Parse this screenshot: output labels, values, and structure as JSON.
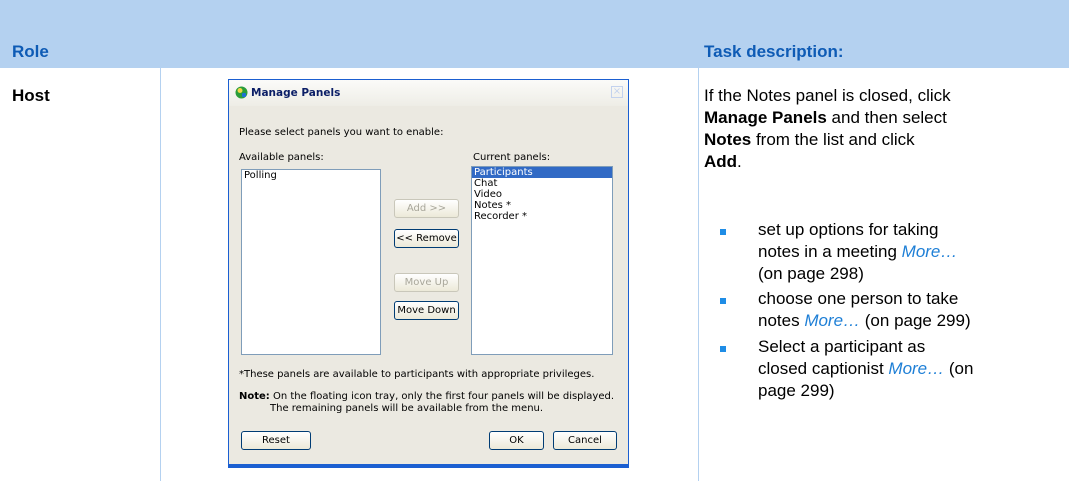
{
  "table": {
    "header": {
      "role": "Role",
      "task": "Task description:"
    },
    "role_value": "Host"
  },
  "dialog": {
    "title": "Manage Panels",
    "close_glyph": "×",
    "prompt": "Please select panels you want to enable:",
    "available_label": "Available panels:",
    "current_label": "Current panels:",
    "available_items": [
      "Polling"
    ],
    "current_items": [
      "Participants",
      "Chat",
      "Video",
      "Notes *",
      "Recorder *"
    ],
    "buttons": {
      "add": "Add >>",
      "remove": "<< Remove",
      "move_up": "Move Up",
      "move_down": "Move Down",
      "reset": "Reset",
      "ok": "OK",
      "cancel": "Cancel"
    },
    "footnote": "*These panels are available to participants with appropriate privileges.",
    "note_label": "Note:",
    "note_line1": "On the floating icon tray, only the first four panels will be displayed.",
    "note_line2": "The remaining panels will be available from the menu."
  },
  "task": {
    "intro_1": "If the Notes panel is closed, click",
    "intro_b1": "Manage Panels",
    "intro_2": " and then select",
    "intro_b2": "Notes",
    "intro_3": " from the list and click",
    "intro_b3": "Add",
    "intro_4": ".",
    "bullets": [
      {
        "l1": "set up options for taking",
        "l2a": "notes in a meeting ",
        "more": "More…",
        "l3": "(on page 298)"
      },
      {
        "l1": "choose one person to take",
        "l2a": "notes ",
        "more": "More…",
        "l2b": " (on page 299)"
      },
      {
        "l1": "Select a participant as",
        "l2a": "closed captionist ",
        "more": "More…",
        "l2b": " (on",
        "l3": "page 299)"
      }
    ]
  },
  "colors": {
    "header_band": "#b4d1f0",
    "header_text": "#0e5bb5",
    "link": "#1e7fd6",
    "bullet": "#1f8de6",
    "dialog_border": "#1b5fd1"
  }
}
